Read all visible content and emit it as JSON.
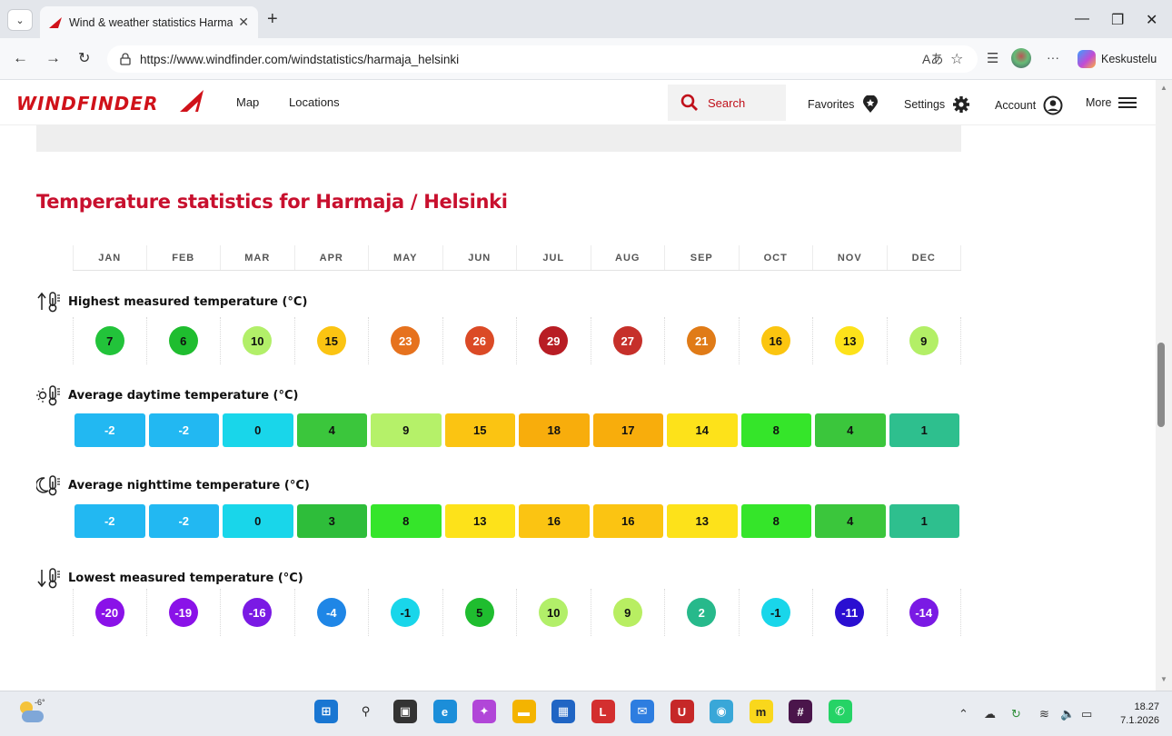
{
  "browser": {
    "tab_title": "Wind & weather statistics Harmaja",
    "tab_close": "✕",
    "new_tab": "+",
    "url": "https://www.windfinder.com/windstatistics/harmaja_helsinki",
    "copilot_label": "Keskustelu",
    "more_dots": "···",
    "window_controls": [
      "—",
      "❐",
      "✕"
    ]
  },
  "site": {
    "logo": "WINDFINDER",
    "nav": [
      "Map",
      "Locations"
    ],
    "search_label": "Search",
    "favorites": "Favorites",
    "settings": "Settings",
    "account": "Account",
    "more": "More"
  },
  "content": {
    "heading": "Temperature statistics for Harmaja / Helsinki",
    "months": [
      "JAN",
      "FEB",
      "MAR",
      "APR",
      "MAY",
      "JUN",
      "JUL",
      "AUG",
      "SEP",
      "OCT",
      "NOV",
      "DEC"
    ],
    "rows": [
      {
        "label": "Highest measured temperature (°C)",
        "icon": "thermometer-up-icon",
        "style": "circle",
        "values": [
          "7",
          "6",
          "10",
          "15",
          "23",
          "26",
          "29",
          "27",
          "21",
          "16",
          "13",
          "9"
        ],
        "colors": [
          "#22c33a",
          "#1fbd2f",
          "#b2ef69",
          "#fbc412",
          "#e6721e",
          "#db4a26",
          "#b81d24",
          "#c6302a",
          "#e07b17",
          "#fbc510",
          "#fde21a",
          "#b3ef66"
        ],
        "text_colors": [
          "#111",
          "#111",
          "#111",
          "#111",
          "#fff",
          "#fff",
          "#fff",
          "#fff",
          "#fff",
          "#111",
          "#111",
          "#111"
        ]
      },
      {
        "label": "Average daytime temperature (°C)",
        "icon": "sun-thermometer-icon",
        "style": "rect",
        "values": [
          "-2",
          "-2",
          "0",
          "4",
          "9",
          "15",
          "18",
          "17",
          "14",
          "8",
          "4",
          "1"
        ],
        "colors": [
          "#22b8f2",
          "#22b8f2",
          "#19d6ea",
          "#3bc63c",
          "#b5f169",
          "#fbc412",
          "#f8ad0c",
          "#f8ad0c",
          "#fde21a",
          "#35e52a",
          "#3bc63c",
          "#2ebf8e"
        ],
        "text_colors": [
          "#fff",
          "#fff",
          "#111",
          "#111",
          "#111",
          "#111",
          "#111",
          "#111",
          "#111",
          "#111",
          "#111",
          "#111"
        ]
      },
      {
        "label": "Average nighttime temperature (°C)",
        "icon": "moon-thermometer-icon",
        "style": "rect",
        "values": [
          "-2",
          "-2",
          "0",
          "3",
          "8",
          "13",
          "16",
          "16",
          "13",
          "8",
          "4",
          "1"
        ],
        "colors": [
          "#22b8f2",
          "#22b8f2",
          "#19d6ea",
          "#2ebd3a",
          "#35e52a",
          "#fde21a",
          "#fbc412",
          "#fbc412",
          "#fde21a",
          "#35e52a",
          "#3bc63c",
          "#2ebf8e"
        ],
        "text_colors": [
          "#fff",
          "#fff",
          "#111",
          "#111",
          "#111",
          "#111",
          "#111",
          "#111",
          "#111",
          "#111",
          "#111",
          "#111"
        ]
      },
      {
        "label": "Lowest measured temperature (°C)",
        "icon": "thermometer-down-icon",
        "style": "circle",
        "values": [
          "-20",
          "-19",
          "-16",
          "-4",
          "-1",
          "5",
          "10",
          "9",
          "2",
          "-1",
          "-11",
          "-14"
        ],
        "colors": [
          "#8a12e8",
          "#8a12e8",
          "#7a1ae4",
          "#1f86e6",
          "#19d6ea",
          "#1fbd2f",
          "#b2ef69",
          "#b8ee62",
          "#27b98b",
          "#19d6ea",
          "#2a0fd1",
          "#7a1ae4"
        ],
        "text_colors": [
          "#fff",
          "#fff",
          "#fff",
          "#fff",
          "#111",
          "#111",
          "#111",
          "#111",
          "#fff",
          "#111",
          "#fff",
          "#fff"
        ]
      }
    ]
  },
  "taskbar": {
    "weather_temp": "-6°",
    "time": "18.27",
    "date": "7.1.2026",
    "apps": [
      {
        "name": "start-icon",
        "color": "#1976d2",
        "glyph": "⊞"
      },
      {
        "name": "search-icon",
        "color": "transparent",
        "glyph": "⚲"
      },
      {
        "name": "task-view-icon",
        "color": "#333",
        "glyph": "▣"
      },
      {
        "name": "edge-icon",
        "color": "#1c8ed9",
        "glyph": "e"
      },
      {
        "name": "copilot-icon",
        "color": "#b146d8",
        "glyph": "✦"
      },
      {
        "name": "file-explorer-icon",
        "color": "#f4b400",
        "glyph": "▬"
      },
      {
        "name": "store-icon",
        "color": "#2065c4",
        "glyph": "▦"
      },
      {
        "name": "app-l-icon",
        "color": "#d32f2f",
        "glyph": "L"
      },
      {
        "name": "outlook-icon",
        "color": "#2d7de0",
        "glyph": "✉"
      },
      {
        "name": "mcafee-icon",
        "color": "#c62828",
        "glyph": "U"
      },
      {
        "name": "app-eye-icon",
        "color": "#39a7d8",
        "glyph": "◉"
      },
      {
        "name": "miro-icon",
        "color": "#f9d71c",
        "glyph": "m"
      },
      {
        "name": "slack-icon",
        "color": "#4a154b",
        "glyph": "#"
      },
      {
        "name": "whatsapp-icon",
        "color": "#25d366",
        "glyph": "✆"
      }
    ]
  }
}
